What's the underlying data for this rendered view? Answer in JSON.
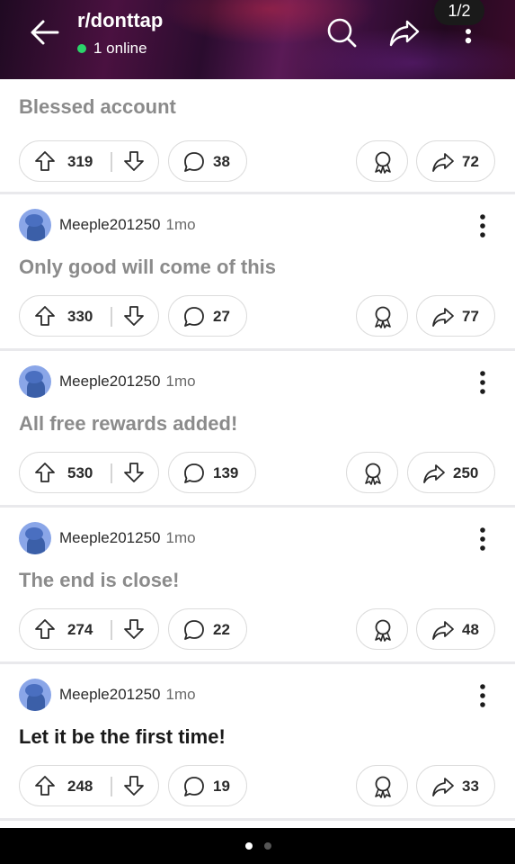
{
  "header": {
    "subreddit": "r/donttap",
    "online_text": "1 online",
    "page_indicator": "1/2"
  },
  "posts": [
    {
      "author": "",
      "age": "",
      "title": "Blessed account",
      "title_dark": false,
      "score": "319",
      "comments": "38",
      "shares": "72"
    },
    {
      "author": "Meeple201250",
      "age": "1mo",
      "title": "Only good will come of this",
      "title_dark": false,
      "score": "330",
      "comments": "27",
      "shares": "77"
    },
    {
      "author": "Meeple201250",
      "age": "1mo",
      "title": "All free rewards added!",
      "title_dark": false,
      "score": "530",
      "comments": "139",
      "shares": "250"
    },
    {
      "author": "Meeple201250",
      "age": "1mo",
      "title": "The end is close!",
      "title_dark": false,
      "score": "274",
      "comments": "22",
      "shares": "48"
    },
    {
      "author": "Meeple201250",
      "age": "1mo",
      "title": "Let it be the first time!",
      "title_dark": true,
      "score": "248",
      "comments": "19",
      "shares": "33"
    }
  ],
  "colors": {
    "online_dot": "#2bd46a",
    "header_bg": "#3a0f3c",
    "muted_title": "#8b8b8b"
  },
  "icons": [
    "back-arrow-icon",
    "search-icon",
    "share-icon",
    "more-vertical-icon",
    "upvote-icon",
    "downvote-icon",
    "comment-icon",
    "award-icon"
  ]
}
